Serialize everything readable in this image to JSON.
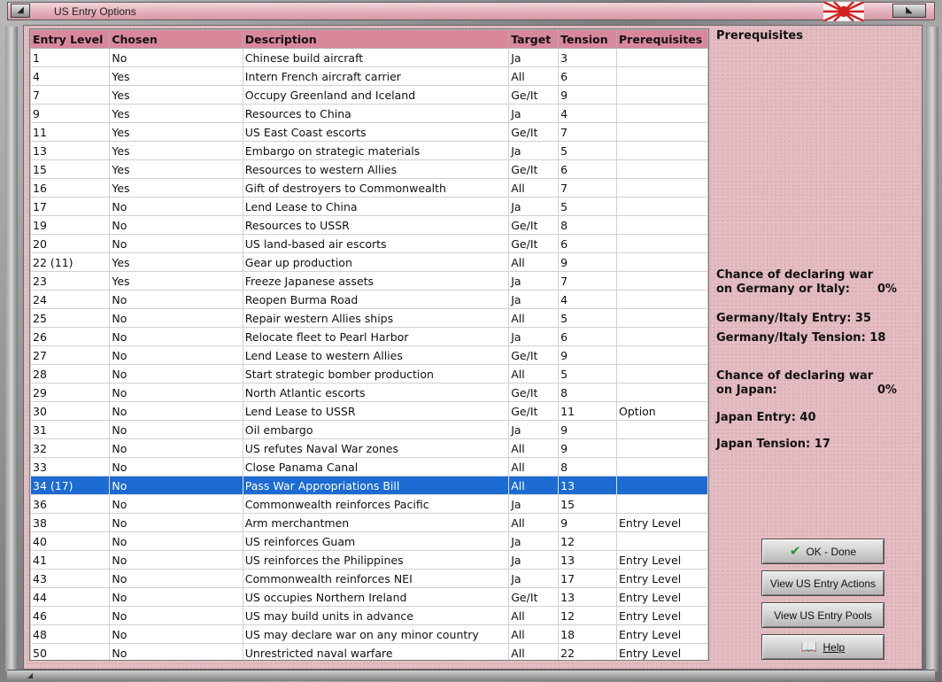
{
  "window": {
    "title": "US Entry Options"
  },
  "table": {
    "headers": [
      "Entry Level",
      "Chosen",
      "Description",
      "Target",
      "Tension",
      "Prerequisites"
    ],
    "rows": [
      [
        "1",
        "No",
        "Chinese build aircraft",
        "Ja",
        "3",
        ""
      ],
      [
        "4",
        "Yes",
        "Intern French aircraft carrier",
        "All",
        "6",
        ""
      ],
      [
        "7",
        "Yes",
        "Occupy Greenland and Iceland",
        "Ge/It",
        "9",
        ""
      ],
      [
        "9",
        "Yes",
        "Resources to China",
        "Ja",
        "4",
        ""
      ],
      [
        "11",
        "Yes",
        "US East Coast escorts",
        "Ge/It",
        "7",
        ""
      ],
      [
        "13",
        "Yes",
        "Embargo on strategic materials",
        "Ja",
        "5",
        ""
      ],
      [
        "15",
        "Yes",
        "Resources to western Allies",
        "Ge/It",
        "6",
        ""
      ],
      [
        "16",
        "Yes",
        "Gift of destroyers to Commonwealth",
        "All",
        "7",
        ""
      ],
      [
        "17",
        "No",
        "Lend Lease to China",
        "Ja",
        "5",
        ""
      ],
      [
        "19",
        "No",
        "Resources to USSR",
        "Ge/It",
        "8",
        ""
      ],
      [
        "20",
        "No",
        "US land-based air escorts",
        "Ge/It",
        "6",
        ""
      ],
      [
        "22 (11)",
        "Yes",
        "Gear up production",
        "All",
        "9",
        ""
      ],
      [
        "23",
        "Yes",
        "Freeze Japanese assets",
        "Ja",
        "7",
        ""
      ],
      [
        "24",
        "No",
        "Reopen Burma Road",
        "Ja",
        "4",
        ""
      ],
      [
        "25",
        "No",
        "Repair western Allies ships",
        "All",
        "5",
        ""
      ],
      [
        "26",
        "No",
        "Relocate fleet to Pearl Harbor",
        "Ja",
        "6",
        ""
      ],
      [
        "27",
        "No",
        "Lend Lease to western Allies",
        "Ge/It",
        "9",
        ""
      ],
      [
        "28",
        "No",
        "Start strategic bomber production",
        "All",
        "5",
        ""
      ],
      [
        "29",
        "No",
        "North Atlantic escorts",
        "Ge/It",
        "8",
        ""
      ],
      [
        "30",
        "No",
        "Lend Lease to USSR",
        "Ge/It",
        "11",
        "Option"
      ],
      [
        "31",
        "No",
        "Oil embargo",
        "Ja",
        "9",
        ""
      ],
      [
        "32",
        "No",
        "US refutes Naval War zones",
        "All",
        "9",
        ""
      ],
      [
        "33",
        "No",
        "Close Panama Canal",
        "All",
        "8",
        ""
      ],
      [
        "34 (17)",
        "No",
        "Pass War Appropriations Bill",
        "All",
        "13",
        ""
      ],
      [
        "36",
        "No",
        "Commonwealth reinforces Pacific",
        "Ja",
        "15",
        ""
      ],
      [
        "38",
        "No",
        "Arm merchantmen",
        "All",
        "9",
        "Entry Level"
      ],
      [
        "40",
        "No",
        "US reinforces Guam",
        "Ja",
        "12",
        ""
      ],
      [
        "41",
        "No",
        "US reinforces the Philippines",
        "Ja",
        "13",
        "Entry Level"
      ],
      [
        "43",
        "No",
        "Commonwealth reinforces NEI",
        "Ja",
        "17",
        "Entry Level"
      ],
      [
        "44",
        "No",
        "US occupies Northern Ireland",
        "Ge/It",
        "13",
        "Entry Level"
      ],
      [
        "46",
        "No",
        "US may build units in advance",
        "All",
        "12",
        "Entry Level"
      ],
      [
        "48",
        "No",
        "US may declare war on any minor country",
        "All",
        "18",
        "Entry Level"
      ],
      [
        "50",
        "No",
        "Unrestricted naval warfare",
        "All",
        "22",
        "Entry Level"
      ]
    ],
    "selected_row": "34 (17)"
  },
  "info": {
    "heading": "Prerequisites",
    "germany_chance_line1": "Chance of declaring war",
    "germany_chance_line2": "on Germany or Italy:",
    "germany_chance_value": "0%",
    "germany_entry": "Germany/Italy Entry: 35",
    "germany_tension": "Germany/Italy Tension: 18",
    "japan_chance_line1": "Chance of declaring war",
    "japan_chance_line2": "on Japan:",
    "japan_chance_value": "0%",
    "japan_entry": "Japan Entry: 40",
    "japan_tension": "Japan Tension: 17"
  },
  "buttons": {
    "ok": "OK - Done",
    "view_actions": "View US Entry Actions",
    "view_pools": "View US Entry Pools",
    "help": "Help"
  },
  "icons": {
    "ok_icon": "checkmark-icon",
    "help_icon": "book-icon",
    "flag": "rising-sun-flag"
  },
  "colors": {
    "header_bg": "#d9889c",
    "selected_row_bg": "#1c6bd2",
    "panel_bg": "#e2b9bf"
  }
}
